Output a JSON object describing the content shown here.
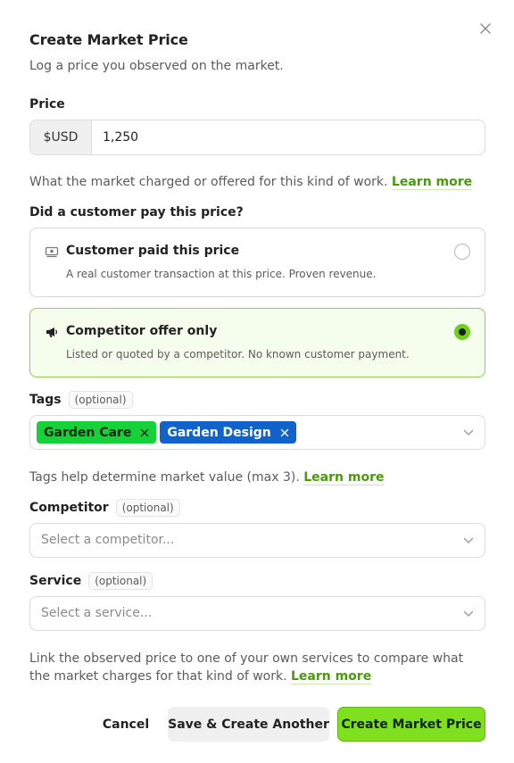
{
  "dialog": {
    "title": "Create Market Price",
    "subtitle": "Log a price you observed on the market."
  },
  "price": {
    "label": "Price",
    "currency_prefix": "$USD",
    "value": "1,250",
    "help_text": "What the market charged or offered for this kind of work.",
    "help_link": "Learn more"
  },
  "customer_paid": {
    "question": "Did a customer pay this price?",
    "options": [
      {
        "title": "Customer paid this price",
        "description": "A real customer transaction at this price. Proven revenue.",
        "icon": "cash-icon",
        "selected": false
      },
      {
        "title": "Competitor offer only",
        "description": "Listed or quoted by a competitor. No known customer payment.",
        "icon": "megaphone-icon",
        "selected": true
      }
    ]
  },
  "tags": {
    "label": "Tags",
    "optional": "(optional)",
    "items": [
      {
        "name": "Garden Care",
        "color": "#16d13a"
      },
      {
        "name": "Garden Design",
        "color": "#1162c9"
      }
    ],
    "help_text": "Tags help determine market value (max 3).",
    "help_link": "Learn more"
  },
  "competitor": {
    "label": "Competitor",
    "optional": "(optional)",
    "placeholder": "Select a competitor..."
  },
  "service": {
    "label": "Service",
    "optional": "(optional)",
    "placeholder": "Select a service...",
    "help_text": "Link the observed price to one of your own services to compare what the market charges for that kind of work.",
    "help_link": "Learn more"
  },
  "footer": {
    "cancel_label": "Cancel",
    "save_another_label": "Save & Create Another",
    "create_label": "Create Market Price"
  },
  "colors": {
    "accent": "#7ee01f",
    "link": "#4a9a0c",
    "selected_card_bg": "#f5fdec",
    "selected_card_border": "#8fd14f"
  }
}
